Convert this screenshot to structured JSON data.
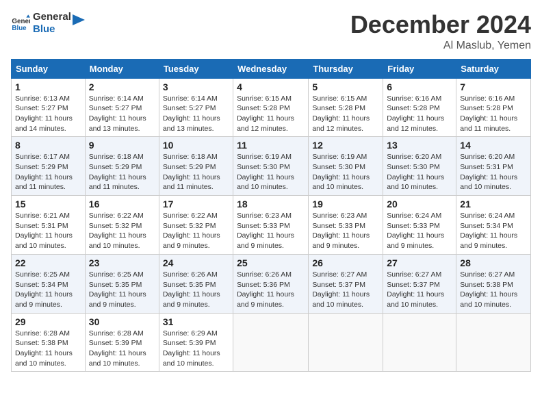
{
  "logo": {
    "line1": "General",
    "line2": "Blue"
  },
  "title": "December 2024",
  "location": "Al Maslub, Yemen",
  "days_of_week": [
    "Sunday",
    "Monday",
    "Tuesday",
    "Wednesday",
    "Thursday",
    "Friday",
    "Saturday"
  ],
  "weeks": [
    [
      {
        "day": "1",
        "info": "Sunrise: 6:13 AM\nSunset: 5:27 PM\nDaylight: 11 hours\nand 14 minutes."
      },
      {
        "day": "2",
        "info": "Sunrise: 6:14 AM\nSunset: 5:27 PM\nDaylight: 11 hours\nand 13 minutes."
      },
      {
        "day": "3",
        "info": "Sunrise: 6:14 AM\nSunset: 5:27 PM\nDaylight: 11 hours\nand 13 minutes."
      },
      {
        "day": "4",
        "info": "Sunrise: 6:15 AM\nSunset: 5:28 PM\nDaylight: 11 hours\nand 12 minutes."
      },
      {
        "day": "5",
        "info": "Sunrise: 6:15 AM\nSunset: 5:28 PM\nDaylight: 11 hours\nand 12 minutes."
      },
      {
        "day": "6",
        "info": "Sunrise: 6:16 AM\nSunset: 5:28 PM\nDaylight: 11 hours\nand 12 minutes."
      },
      {
        "day": "7",
        "info": "Sunrise: 6:16 AM\nSunset: 5:28 PM\nDaylight: 11 hours\nand 11 minutes."
      }
    ],
    [
      {
        "day": "8",
        "info": "Sunrise: 6:17 AM\nSunset: 5:29 PM\nDaylight: 11 hours\nand 11 minutes."
      },
      {
        "day": "9",
        "info": "Sunrise: 6:18 AM\nSunset: 5:29 PM\nDaylight: 11 hours\nand 11 minutes."
      },
      {
        "day": "10",
        "info": "Sunrise: 6:18 AM\nSunset: 5:29 PM\nDaylight: 11 hours\nand 11 minutes."
      },
      {
        "day": "11",
        "info": "Sunrise: 6:19 AM\nSunset: 5:30 PM\nDaylight: 11 hours\nand 10 minutes."
      },
      {
        "day": "12",
        "info": "Sunrise: 6:19 AM\nSunset: 5:30 PM\nDaylight: 11 hours\nand 10 minutes."
      },
      {
        "day": "13",
        "info": "Sunrise: 6:20 AM\nSunset: 5:30 PM\nDaylight: 11 hours\nand 10 minutes."
      },
      {
        "day": "14",
        "info": "Sunrise: 6:20 AM\nSunset: 5:31 PM\nDaylight: 11 hours\nand 10 minutes."
      }
    ],
    [
      {
        "day": "15",
        "info": "Sunrise: 6:21 AM\nSunset: 5:31 PM\nDaylight: 11 hours\nand 10 minutes."
      },
      {
        "day": "16",
        "info": "Sunrise: 6:22 AM\nSunset: 5:32 PM\nDaylight: 11 hours\nand 10 minutes."
      },
      {
        "day": "17",
        "info": "Sunrise: 6:22 AM\nSunset: 5:32 PM\nDaylight: 11 hours\nand 9 minutes."
      },
      {
        "day": "18",
        "info": "Sunrise: 6:23 AM\nSunset: 5:33 PM\nDaylight: 11 hours\nand 9 minutes."
      },
      {
        "day": "19",
        "info": "Sunrise: 6:23 AM\nSunset: 5:33 PM\nDaylight: 11 hours\nand 9 minutes."
      },
      {
        "day": "20",
        "info": "Sunrise: 6:24 AM\nSunset: 5:33 PM\nDaylight: 11 hours\nand 9 minutes."
      },
      {
        "day": "21",
        "info": "Sunrise: 6:24 AM\nSunset: 5:34 PM\nDaylight: 11 hours\nand 9 minutes."
      }
    ],
    [
      {
        "day": "22",
        "info": "Sunrise: 6:25 AM\nSunset: 5:34 PM\nDaylight: 11 hours\nand 9 minutes."
      },
      {
        "day": "23",
        "info": "Sunrise: 6:25 AM\nSunset: 5:35 PM\nDaylight: 11 hours\nand 9 minutes."
      },
      {
        "day": "24",
        "info": "Sunrise: 6:26 AM\nSunset: 5:35 PM\nDaylight: 11 hours\nand 9 minutes."
      },
      {
        "day": "25",
        "info": "Sunrise: 6:26 AM\nSunset: 5:36 PM\nDaylight: 11 hours\nand 9 minutes."
      },
      {
        "day": "26",
        "info": "Sunrise: 6:27 AM\nSunset: 5:37 PM\nDaylight: 11 hours\nand 10 minutes."
      },
      {
        "day": "27",
        "info": "Sunrise: 6:27 AM\nSunset: 5:37 PM\nDaylight: 11 hours\nand 10 minutes."
      },
      {
        "day": "28",
        "info": "Sunrise: 6:27 AM\nSunset: 5:38 PM\nDaylight: 11 hours\nand 10 minutes."
      }
    ],
    [
      {
        "day": "29",
        "info": "Sunrise: 6:28 AM\nSunset: 5:38 PM\nDaylight: 11 hours\nand 10 minutes."
      },
      {
        "day": "30",
        "info": "Sunrise: 6:28 AM\nSunset: 5:39 PM\nDaylight: 11 hours\nand 10 minutes."
      },
      {
        "day": "31",
        "info": "Sunrise: 6:29 AM\nSunset: 5:39 PM\nDaylight: 11 hours\nand 10 minutes."
      },
      {
        "day": "",
        "info": ""
      },
      {
        "day": "",
        "info": ""
      },
      {
        "day": "",
        "info": ""
      },
      {
        "day": "",
        "info": ""
      }
    ]
  ]
}
